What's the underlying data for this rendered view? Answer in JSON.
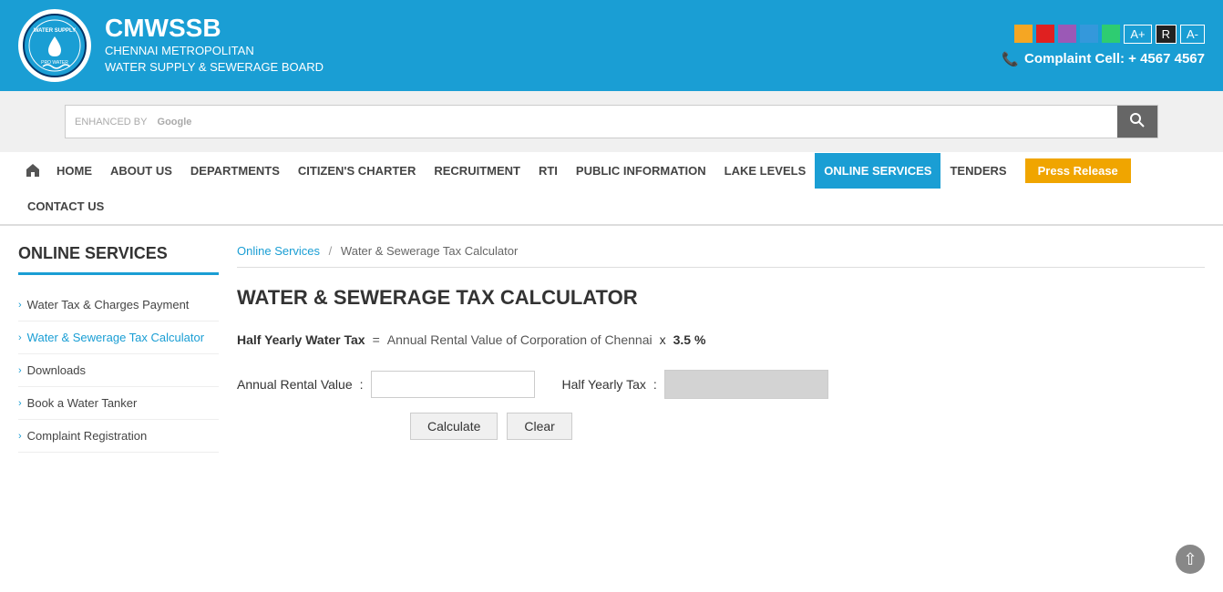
{
  "header": {
    "org_short": "CMWSSB",
    "org_line1": "CHENNAI METROPOLITAN",
    "org_line2": "WATER SUPPLY & SEWERAGE BOARD",
    "complaint_label": "Complaint Cell: + 4567 4567"
  },
  "accessibility": {
    "colors": [
      "#f5a623",
      "#e02020",
      "#9b59b6",
      "#3498db",
      "#2ecc71"
    ],
    "font_increase": "A+",
    "font_reset": "R",
    "font_decrease": "A-"
  },
  "search": {
    "enhanced_label": "ENHANCED BY",
    "google_label": "Google",
    "placeholder": ""
  },
  "nav": {
    "home_icon": "⌂",
    "items": [
      {
        "label": "HOME",
        "active": false
      },
      {
        "label": "ABOUT US",
        "active": false
      },
      {
        "label": "DEPARTMENTS",
        "active": false
      },
      {
        "label": "CITIZEN'S CHARTER",
        "active": false
      },
      {
        "label": "RECRUITMENT",
        "active": false
      },
      {
        "label": "RTI",
        "active": false
      },
      {
        "label": "PUBLIC INFORMATION",
        "active": false
      },
      {
        "label": "LAKE LEVELS",
        "active": false
      },
      {
        "label": "ONLINE SERVICES",
        "active": true
      },
      {
        "label": "TENDERS",
        "active": false
      }
    ],
    "row2": [
      {
        "label": "CONTACT US",
        "active": false
      }
    ],
    "press_release": "Press Release"
  },
  "sidebar": {
    "title": "ONLINE SERVICES",
    "items": [
      {
        "label": "Water Tax & Charges Payment",
        "active": false
      },
      {
        "label": "Water & Sewerage Tax Calculator",
        "active": true
      },
      {
        "label": "Downloads",
        "active": false
      },
      {
        "label": "Book a Water Tanker",
        "active": false
      },
      {
        "label": "Complaint Registration",
        "active": false
      }
    ]
  },
  "breadcrumb": {
    "link": "Online Services",
    "sep": "/",
    "current": "Water & Sewerage Tax Calculator"
  },
  "calculator": {
    "title": "WATER & SEWERAGE TAX CALCULATOR",
    "formula_label": "Half Yearly Water Tax",
    "formula_equals": "=",
    "formula_value": "Annual Rental Value of Corporation of Chennai",
    "formula_x": "x",
    "formula_percent": "3.5 %",
    "annual_rental_label": "Annual Rental Value",
    "annual_rental_colon": ":",
    "half_yearly_label": "Half Yearly Tax",
    "half_yearly_colon": ":",
    "calculate_btn": "Calculate",
    "clear_btn": "Clear"
  }
}
